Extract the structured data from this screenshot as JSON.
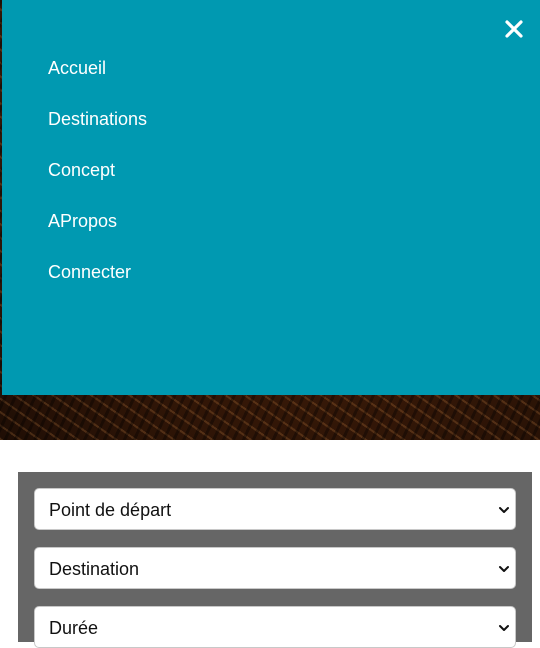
{
  "nav": {
    "items": [
      {
        "label": "Accueil"
      },
      {
        "label": "Destinations"
      },
      {
        "label": "Concept"
      },
      {
        "label": "APropos"
      },
      {
        "label": "Connecter"
      }
    ],
    "close_icon": "close-icon",
    "background_color": "#0099b1"
  },
  "search": {
    "panel_color": "#666666",
    "fields": [
      {
        "selected": "Point de départ"
      },
      {
        "selected": "Destination"
      },
      {
        "selected": "Durée"
      }
    ],
    "chevron_icon": "chevron-down-icon"
  }
}
